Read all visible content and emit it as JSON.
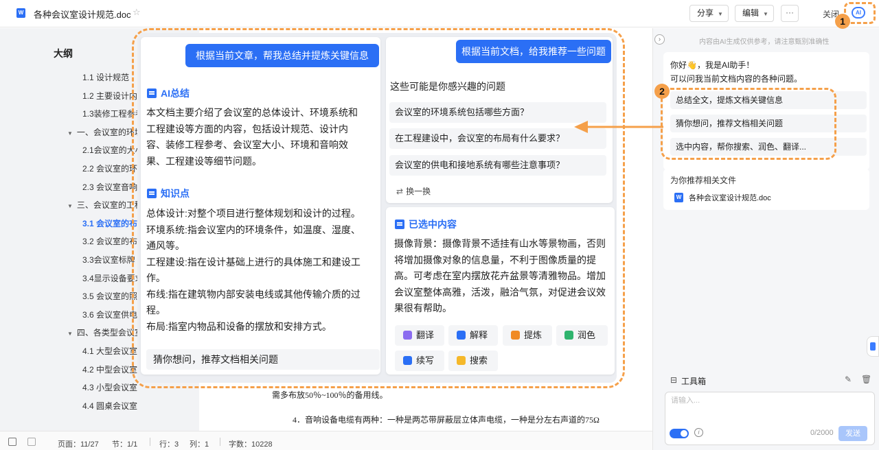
{
  "header": {
    "doc_title": "各种会议室设计规范.doc",
    "share_label": "分享",
    "edit_label": "编辑",
    "more_label": "···",
    "close_label": "关闭",
    "ai_label": "AI"
  },
  "outline": {
    "title": "大纲",
    "items": [
      {
        "label": "1.1 设计规范",
        "level": 2,
        "active": false
      },
      {
        "label": "1.2 主要设计内容",
        "level": 2,
        "active": false
      },
      {
        "label": "1.3装修工程参考",
        "level": 2,
        "active": false
      },
      {
        "label": "一、会议室的环境设计",
        "level": 1,
        "active": false
      },
      {
        "label": "2.1会议室的大小",
        "level": 2,
        "active": false
      },
      {
        "label": "2.2 会议室的环境",
        "level": 2,
        "active": false
      },
      {
        "label": "2.3 会议室音响",
        "level": 2,
        "active": false
      },
      {
        "label": "三、会议室的工程建设",
        "level": 1,
        "active": false
      },
      {
        "label": "3.1 会议室的布局",
        "level": 2,
        "active": true
      },
      {
        "label": "3.2 会议室的布线",
        "level": 2,
        "active": false
      },
      {
        "label": "3.3会议室标牌",
        "level": 2,
        "active": false
      },
      {
        "label": "3.4显示设备要求",
        "level": 2,
        "active": false
      },
      {
        "label": "3.5 会议室的照明",
        "level": 2,
        "active": false
      },
      {
        "label": "3.6 会议室供电",
        "level": 2,
        "active": false
      },
      {
        "label": "四、各类型会议室",
        "level": 1,
        "active": false
      },
      {
        "label": "4.1 大型会议室",
        "level": 2,
        "active": false
      },
      {
        "label": "4.2 中型会议室",
        "level": 2,
        "active": false
      },
      {
        "label": "4.3 小型会议室",
        "level": 2,
        "active": false
      },
      {
        "label": "4.4 圆桌会议室",
        "level": 2,
        "active": false
      }
    ]
  },
  "document": {
    "line1": "需多布放50％~100％的备用线。",
    "line2": "4．音响设备电缆有两种：一种是两芯带屏蔽层立体声电缆，一种是分左右声道的75Ω"
  },
  "status": {
    "page": "页面：11/27",
    "section": "节：1/1",
    "row": "行：3",
    "col": "列：1",
    "words": "字数：10228"
  },
  "ai_panel": {
    "disclaimer": "内容由AI生成仅供参考，请注意甄别准确性",
    "greeting_line1": "你好👋，我是AI助手！",
    "greeting_line2": "可以问我当前文档内容的各种问题。",
    "suggestions": [
      "总结全文，提炼文档关键信息",
      "猜你想问，推荐文档相关问题",
      "选中内容，帮你搜索、润色、翻译..."
    ],
    "recommend_title": "为你推荐相关文件",
    "recommend_file": "各种会议室设计规范.doc",
    "toolbox_label": "工具箱",
    "input_placeholder": "请输入...",
    "char_count": "0/2000",
    "send_label": "发送"
  },
  "overlay": {
    "summary": {
      "user_prompt": "根据当前文章，帮我总结并提炼关键信息",
      "ai_summary_title": "AI总结",
      "ai_summary_lines": [
        "本文档主要介绍了会议室的总体设计、环境系统和",
        "工程建设等方面的内容，包括设计规范、设计内",
        "容、装修工程参考、会议室大小、环境和音响效",
        "果、工程建设等细节问题。"
      ],
      "knowledge_title": "知识点",
      "knowledge_lines": [
        "总体设计:对整个项目进行整体规划和设计的过程。",
        "环境系统:指会议室内的环境条件，如温度、湿度、",
        "通风等。",
        "工程建设:指在设计基础上进行的具体施工和建设工",
        "作。",
        "布线:指在建筑物内部安装电线或其他传输介质的过",
        "程。",
        "布局:指室内物品和设备的摆放和安排方式。"
      ],
      "guess_label": "猜你想问，推荐文档相关问题"
    },
    "questions": {
      "user_prompt": "根据当前文档，给我推荐一些问题",
      "intro": "这些可能是你感兴趣的问题",
      "items": [
        "会议室的环境系统包括哪些方面？",
        "在工程建设中，会议室的布局有什么要求？",
        "会议室的供电和接地系统有哪些注意事项？"
      ],
      "refresh_label": "换一换"
    },
    "selected": {
      "title": "已选中内容",
      "lines": [
        "摄像背景：摄像背景不适挂有山水等景物画，否则",
        "将增加摄像对象的信息量，不利于图像质量的提",
        "高。可考虑在室内摆放花卉盆景等清雅物品。增加",
        "会议室整体高雅，活泼，融洽气氛，对促进会议效",
        "果很有帮助。"
      ],
      "tools": [
        {
          "label": "翻译",
          "color": "#8b6cf0"
        },
        {
          "label": "解释",
          "color": "#2b6ff5"
        },
        {
          "label": "提炼",
          "color": "#f08a24"
        },
        {
          "label": "润色",
          "color": "#2fb46e"
        },
        {
          "label": "续写",
          "color": "#2b6ff5"
        },
        {
          "label": "搜索",
          "color": "#f5b82a"
        }
      ]
    },
    "badges": [
      "1",
      "2"
    ]
  }
}
